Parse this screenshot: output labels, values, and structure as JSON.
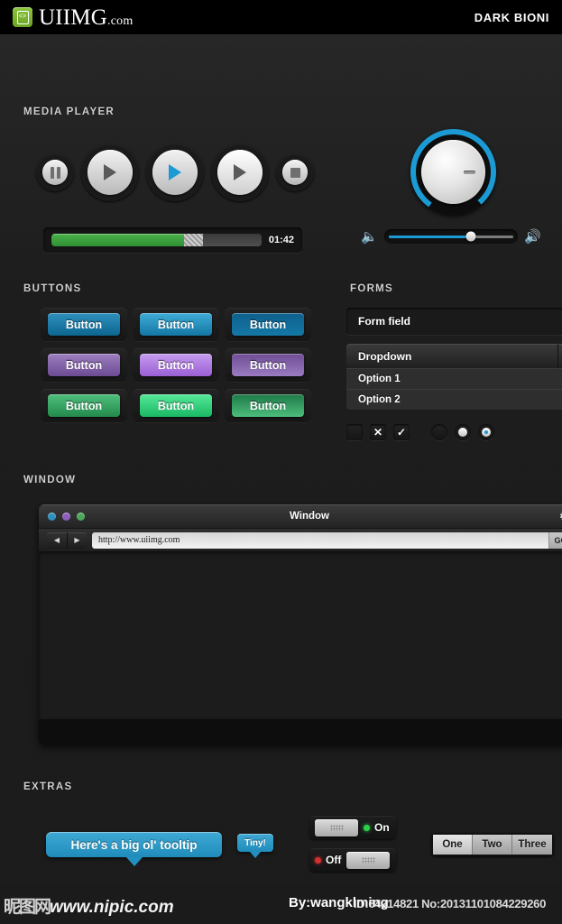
{
  "header": {
    "logo_text": "UIIMG",
    "logo_suffix": ".com",
    "logo_icon_glyph": "<>",
    "title_right": "DARK BIONI"
  },
  "sections": {
    "media_player": "MEDIA PLAYER",
    "buttons": "BUTTONS",
    "forms": "FORMS",
    "window": "WINDOW",
    "extras": "EXTRAS"
  },
  "media_player": {
    "controls": [
      {
        "name": "pause-button",
        "icon": "pause-icon",
        "size": "sm"
      },
      {
        "name": "play-button",
        "icon": "play-icon",
        "size": "lg"
      },
      {
        "name": "play-button-active",
        "icon": "play-icon-blue",
        "size": "lg"
      },
      {
        "name": "play-button-hover",
        "icon": "play-icon",
        "size": "lg"
      },
      {
        "name": "stop-button",
        "icon": "stop-icon",
        "size": "sm"
      }
    ],
    "progress": {
      "played_percent": 63,
      "buffer_percent": 9,
      "time": "01:42",
      "fill_color": "#2f8f32"
    },
    "knob": {
      "arc_percent": 79,
      "arc_color": "#1b9ad4"
    },
    "volume": {
      "level_percent": 66,
      "active_color": "#1b9ad4",
      "icon_low": "speaker-low-icon",
      "icon_high": "speaker-high-icon"
    }
  },
  "buttons": {
    "label": "Button",
    "rows": [
      {
        "color": "blue",
        "variants": [
          "b-blue1",
          "b-blue2",
          "b-blue3"
        ]
      },
      {
        "color": "purple",
        "variants": [
          "b-purp1",
          "b-purp2",
          "b-purp3"
        ]
      },
      {
        "color": "green",
        "variants": [
          "b-grn1",
          "b-grn2",
          "b-grn3"
        ]
      }
    ]
  },
  "forms": {
    "field_value": "Form field",
    "field_placeholder": "Form field",
    "dropdown_label": "Dropdown",
    "dropdown_arrow": "▼",
    "options": [
      "Option 1",
      "Option 2"
    ],
    "checkboxes": [
      {
        "name": "checkbox-empty",
        "glyph": ""
      },
      {
        "name": "checkbox-cross",
        "glyph": "✕"
      },
      {
        "name": "checkbox-checked",
        "glyph": "✓"
      }
    ],
    "radios": [
      {
        "name": "radio-empty",
        "state": "empty"
      },
      {
        "name": "radio-selected",
        "state": "white"
      },
      {
        "name": "radio-selected-blue",
        "state": "blue"
      }
    ]
  },
  "window": {
    "title": "Window",
    "lights": [
      "blue",
      "purple",
      "green"
    ],
    "gear_icon": "⚙",
    "back_arrow": "◀",
    "forward_arrow": "▶",
    "url": "http://www.uiimg.com",
    "go_label": "GO"
  },
  "extras": {
    "tooltip_big": "Here's a big ol' tooltip",
    "tooltip_small": "Tiny!",
    "switch_on_label": "On",
    "switch_off_label": "Off",
    "on_color": "#2bd14a",
    "off_color": "#d63030",
    "segments": [
      "One",
      "Two",
      "Three"
    ],
    "segment_selected": "One"
  },
  "scrollbar": {
    "arrow_glyph": "◀",
    "thumb_position_percent": 66
  },
  "footer": {
    "watermark_cn": "昵图网",
    "watermark_site": "www.nipic.com",
    "author": "By:wangklming",
    "id_text": "ID:64214821 No:20131101084229260"
  }
}
